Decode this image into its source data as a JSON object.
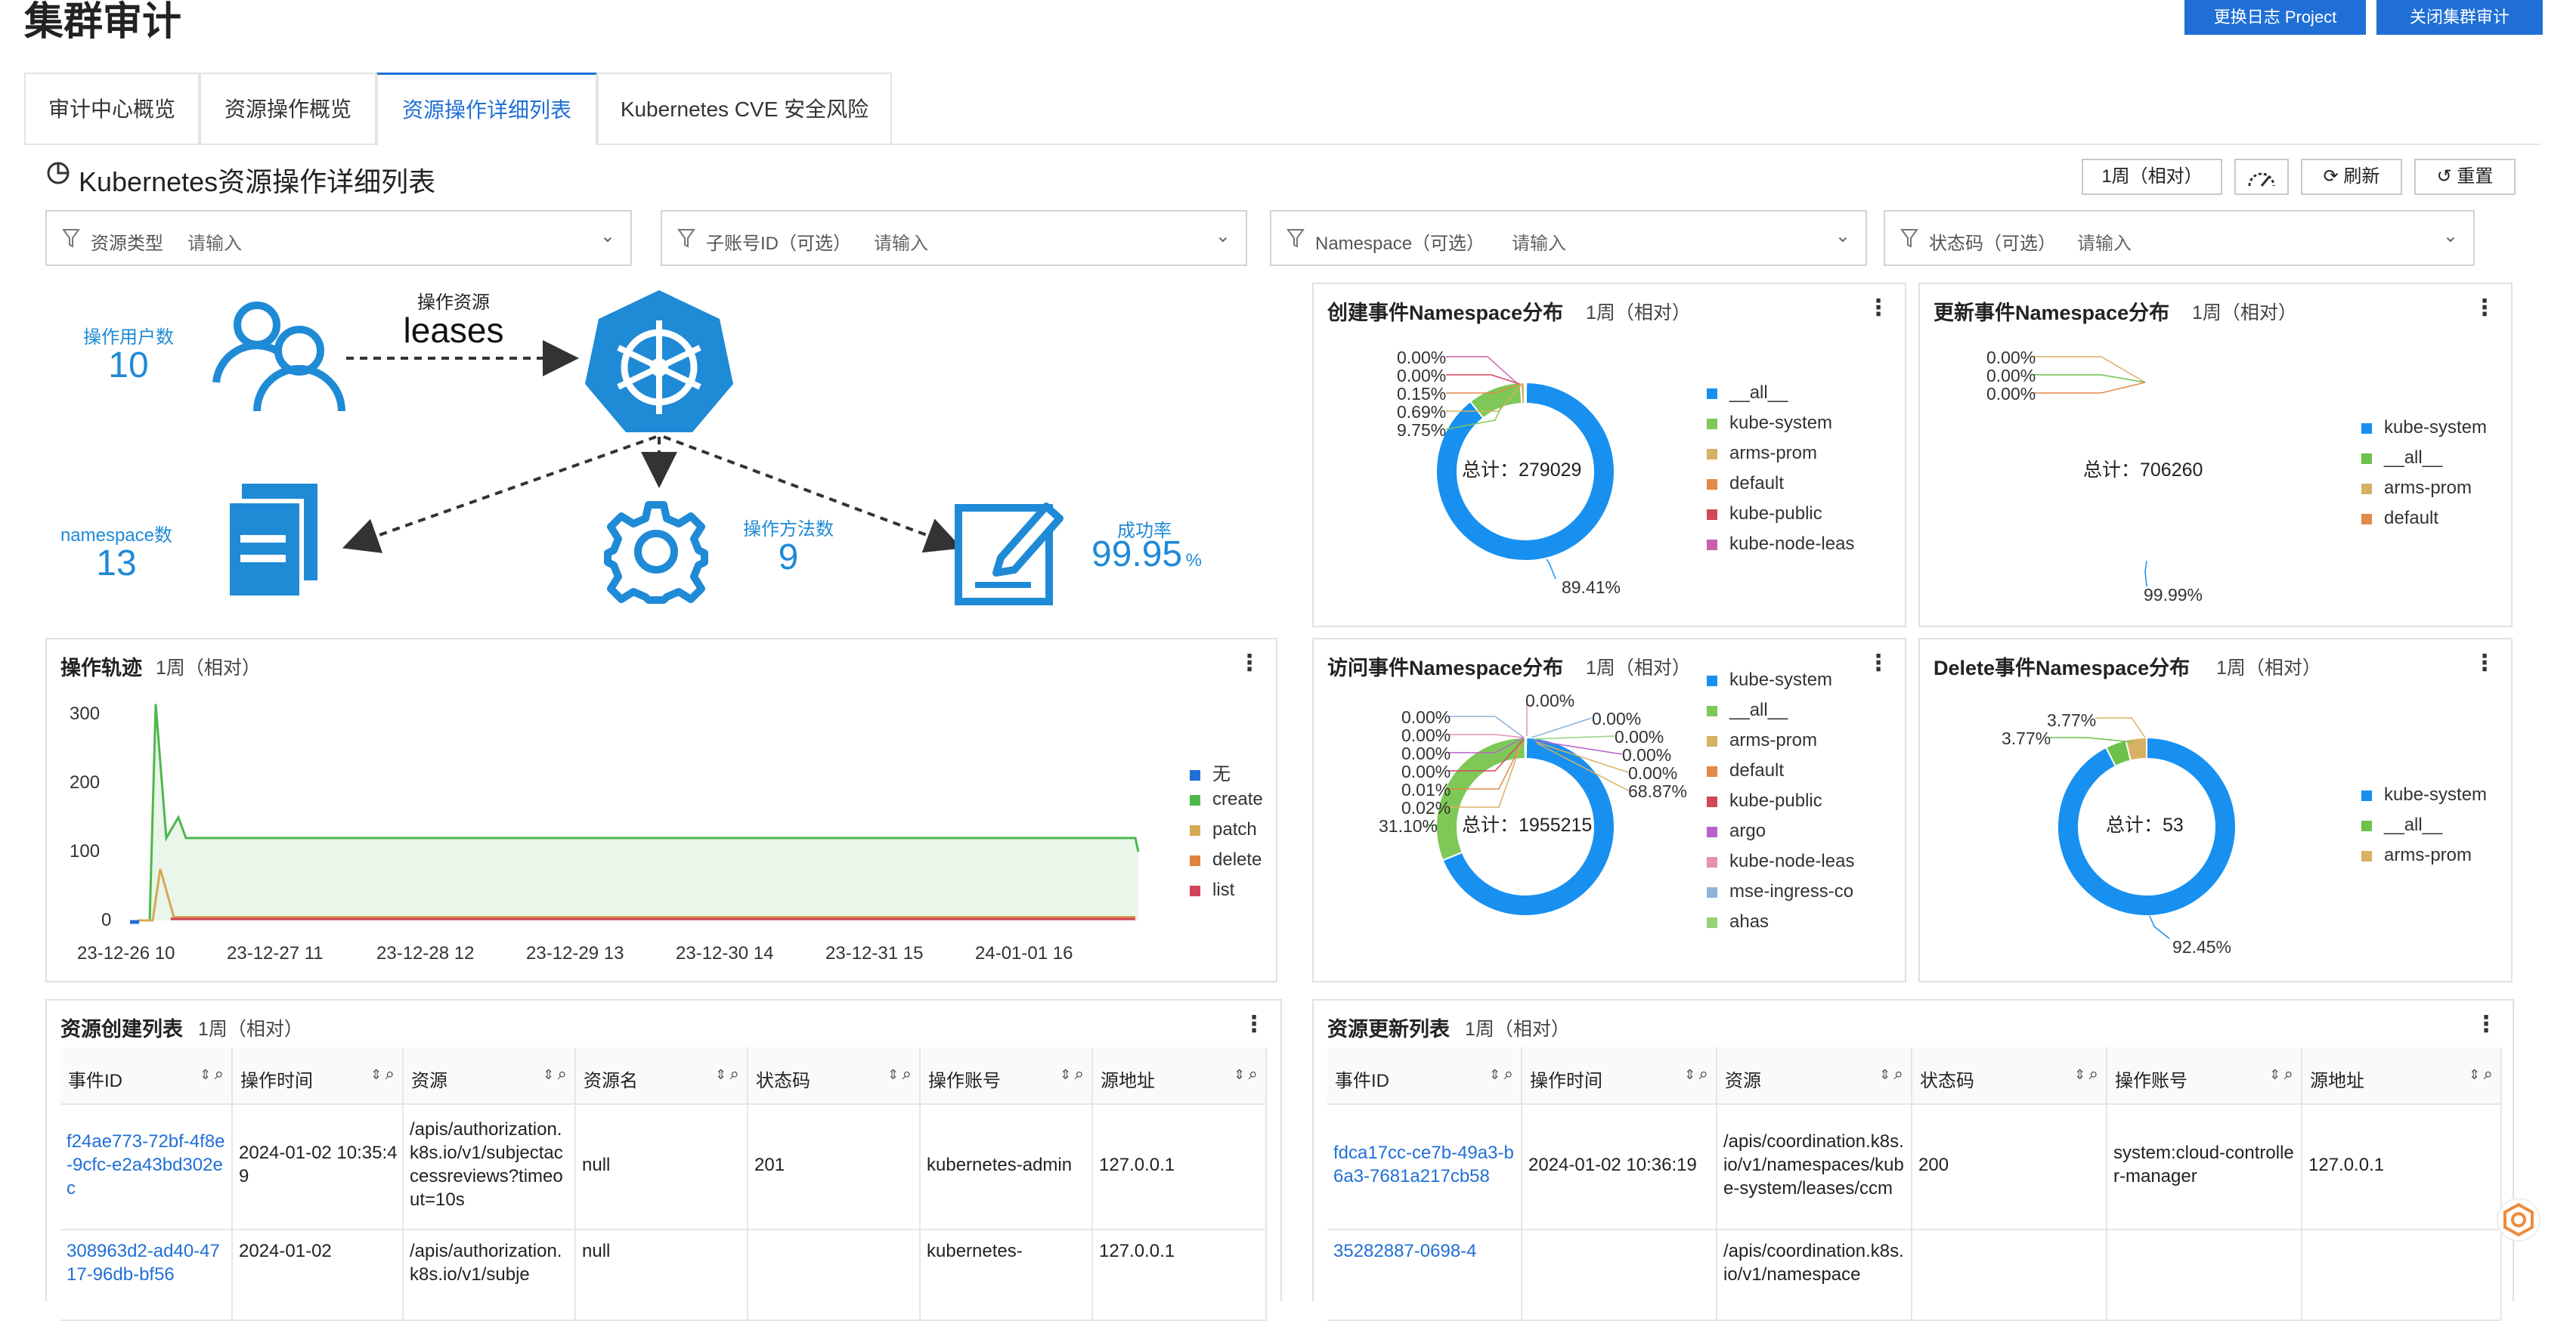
{
  "header": {
    "title": "集群审计",
    "btn_change_project": "更换日志 Project",
    "btn_close_audit": "关闭集群审计"
  },
  "tabs": [
    {
      "label": "审计中心概览"
    },
    {
      "label": "资源操作概览"
    },
    {
      "label": "资源操作详细列表"
    },
    {
      "label": "Kubernetes CVE 安全风险"
    }
  ],
  "section": {
    "title": "Kubernetes资源操作详细列表",
    "time_range": "1周（相对）",
    "refresh": "刷新",
    "reset": "重置"
  },
  "filters": [
    {
      "label": "资源类型",
      "placeholder": "请输入"
    },
    {
      "label": "子账号ID（可选）",
      "placeholder": "请输入"
    },
    {
      "label": "Namespace（可选）",
      "placeholder": "请输入"
    },
    {
      "label": "状态码（可选）",
      "placeholder": "请输入"
    }
  ],
  "overview": {
    "users_label": "操作用户数",
    "users_value": "10",
    "resource_label": "操作资源",
    "resource_value": "leases",
    "namespace_label": "namespace数",
    "namespace_value": "13",
    "methods_label": "操作方法数",
    "methods_value": "9",
    "success_label": "成功率",
    "success_value": "99.95",
    "success_unit": "%"
  },
  "trail": {
    "title": "操作轨迹",
    "sub": "1周（相对）",
    "legend": [
      {
        "name": "无",
        "color": "#1f6fd6"
      },
      {
        "name": "create",
        "color": "#4cb84c"
      },
      {
        "name": "patch",
        "color": "#d4aa55"
      },
      {
        "name": "delete",
        "color": "#e0833c"
      },
      {
        "name": "list",
        "color": "#d0455b"
      }
    ]
  },
  "chart_data": [
    {
      "type": "line",
      "title": "操作轨迹",
      "x": [
        "23-12-26 10",
        "23-12-27 11",
        "23-12-28 12",
        "23-12-29 13",
        "23-12-30 14",
        "23-12-31 15",
        "24-01-01 16"
      ],
      "yticks": [
        0,
        100,
        200,
        300
      ],
      "ylim": [
        0,
        330
      ],
      "series": [
        {
          "name": "create",
          "color": "#4cb84c",
          "values": [
            120,
            120,
            120,
            120,
            120,
            120,
            120
          ],
          "peak": 315
        },
        {
          "name": "patch",
          "color": "#d4aa55",
          "values": [
            5,
            5,
            5,
            5,
            5,
            5,
            5
          ],
          "peak": 75
        },
        {
          "name": "delete",
          "color": "#e0833c",
          "values": [
            3,
            3,
            3,
            3,
            3,
            3,
            3
          ]
        },
        {
          "name": "list",
          "color": "#d0455b",
          "values": [
            2,
            2,
            2,
            2,
            2,
            2,
            2
          ]
        },
        {
          "name": "无",
          "color": "#1f6fd6",
          "values": [
            0
          ]
        }
      ]
    },
    {
      "type": "pie",
      "title": "创建事件Namespace分布",
      "center_text": "总计：279029",
      "slices": [
        {
          "name": "__all__",
          "value": 89.41,
          "color": "#1890f0"
        },
        {
          "name": "kube-system",
          "value": 9.75,
          "color": "#7dc856"
        },
        {
          "name": "arms-prom",
          "value": 0.69,
          "color": "#d8b063"
        },
        {
          "name": "default",
          "value": 0.15,
          "color": "#e28a48"
        },
        {
          "name": "kube-public",
          "value": 0.0,
          "color": "#d3455b"
        },
        {
          "name": "kube-node-leas",
          "value": 0.0,
          "color": "#c85fae"
        }
      ],
      "labels": [
        "0.00%",
        "0.00%",
        "0.15%",
        "0.69%",
        "9.75%",
        "89.41%"
      ]
    },
    {
      "type": "pie",
      "title": "更新事件Namespace分布",
      "center_text": "总计：706260",
      "slices": [
        {
          "name": "kube-system",
          "value": 99.99,
          "color": "#1890f0"
        },
        {
          "name": "__all__",
          "value": 0.0,
          "color": "#6cc24a"
        },
        {
          "name": "arms-prom",
          "value": 0.0,
          "color": "#d8b063"
        },
        {
          "name": "default",
          "value": 0.0,
          "color": "#e28a48"
        }
      ],
      "labels": [
        "0.00%",
        "0.00%",
        "0.00%",
        "99.99%"
      ]
    },
    {
      "type": "pie",
      "title": "访问事件Namespace分布",
      "center_text": "总计：1955215",
      "slices": [
        {
          "name": "kube-system",
          "value": 68.87,
          "color": "#1890f0"
        },
        {
          "name": "__all__",
          "value": 31.1,
          "color": "#7dc856"
        },
        {
          "name": "arms-prom",
          "value": 0.02,
          "color": "#d8b063"
        },
        {
          "name": "default",
          "value": 0.01,
          "color": "#e28a48"
        },
        {
          "name": "kube-public",
          "value": 0.0,
          "color": "#d3455b"
        },
        {
          "name": "argo",
          "value": 0.0,
          "color": "#b464c8"
        },
        {
          "name": "kube-node-leas",
          "value": 0.0,
          "color": "#e690b4"
        },
        {
          "name": "mse-ingress-co",
          "value": 0.0,
          "color": "#8fb4d8"
        },
        {
          "name": "ahas",
          "value": 0.0,
          "color": "#94d27a"
        }
      ],
      "labels": [
        "0.00%",
        "0.00%",
        "0.00%",
        "0.00%",
        "0.01%",
        "0.02%",
        "31.10%",
        "0.00%",
        "0.00%",
        "0.00%",
        "0.00%",
        "0.00%",
        "68.87%"
      ]
    },
    {
      "type": "pie",
      "title": "Delete事件Namespace分布",
      "center_text": "总计：53",
      "slices": [
        {
          "name": "kube-system",
          "value": 92.45,
          "color": "#1890f0"
        },
        {
          "name": "__all__",
          "value": 3.77,
          "color": "#6cc24a"
        },
        {
          "name": "arms-prom",
          "value": 3.77,
          "color": "#d8b063"
        }
      ],
      "labels": [
        "3.77%",
        "3.77%",
        "92.45%"
      ]
    }
  ],
  "pies": {
    "create": {
      "title": "创建事件Namespace分布",
      "sub": "1周（相对）"
    },
    "update": {
      "title": "更新事件Namespace分布",
      "sub": "1周（相对）"
    },
    "access": {
      "title": "访问事件Namespace分布",
      "sub": "1周（相对）"
    },
    "delete": {
      "title": "Delete事件Namespace分布",
      "sub": "1周（相对）"
    }
  },
  "create_table": {
    "title": "资源创建列表",
    "sub": "1周（相对）",
    "columns": [
      "事件ID",
      "操作时间",
      "资源",
      "资源名",
      "状态码",
      "操作账号",
      "源地址"
    ],
    "rows": [
      {
        "id": "f24ae773-72bf-4f8e-9cfc-e2a43bd302ec",
        "time": "2024-01-02 10:35:49",
        "resource": "/apis/authorization.k8s.io/v1/subjectaccessreviews?timeout=10s",
        "name": "null",
        "code": "201",
        "account": "kubernetes-admin",
        "src": "127.0.0.1"
      },
      {
        "id": "308963d2-ad40-4717-96db-bf56",
        "time": "2024-01-02",
        "resource": "/apis/authorization.k8s.io/v1/subje",
        "name": "null",
        "code": "",
        "account": "kubernetes-",
        "src": "127.0.0.1"
      }
    ]
  },
  "update_table": {
    "title": "资源更新列表",
    "sub": "1周（相对）",
    "columns": [
      "事件ID",
      "操作时间",
      "资源",
      "状态码",
      "操作账号",
      "源地址"
    ],
    "rows": [
      {
        "id": "fdca17cc-ce7b-49a3-b6a3-7681a217cb58",
        "time": "2024-01-02 10:36:19",
        "resource": "/apis/coordination.k8s.io/v1/namespaces/kube-system/leases/ccm",
        "code": "200",
        "account": "system:cloud-controller-manager",
        "src": "127.0.0.1"
      },
      {
        "id": "35282887-0698-4",
        "time": "",
        "resource": "/apis/coordination.k8s.io/v1/namespace",
        "code": "",
        "account": "",
        "src": ""
      }
    ]
  }
}
